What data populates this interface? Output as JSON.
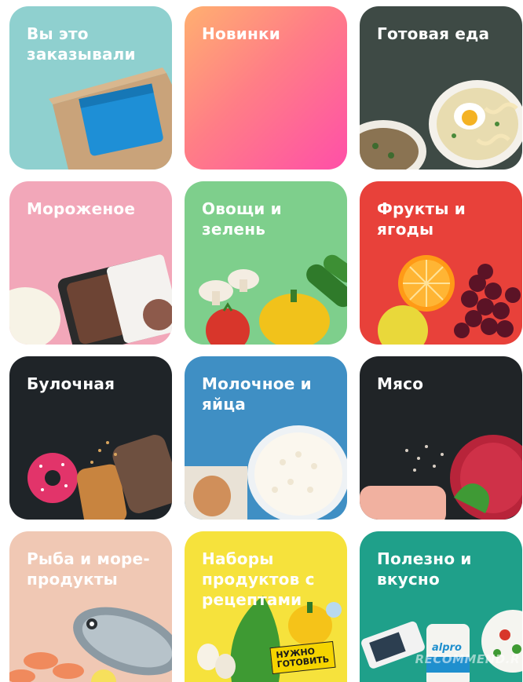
{
  "tiles": [
    {
      "label": "Вы это\nзаказывали"
    },
    {
      "label": "Новинки"
    },
    {
      "label": "Готовая еда"
    },
    {
      "label": "Мороженое"
    },
    {
      "label": "Овощи и\nзелень"
    },
    {
      "label": "Фрукты и\nягоды"
    },
    {
      "label": "Булочная"
    },
    {
      "label": "Молочное и\nяйца"
    },
    {
      "label": "Мясо"
    },
    {
      "label": "Рыба и море-\nпродукты"
    },
    {
      "label": "Наборы\nпродуктов с\nрецептами"
    },
    {
      "label": "Полезно и\nвкусно"
    }
  ],
  "badge": {
    "label": "НУЖНО\nГОТОВИТЬ"
  },
  "product_label": "alpro",
  "watermark": "RECOMMEND.R",
  "colors": {
    "ordered": "#8fd0cf",
    "new_from": "#ff9a6c",
    "new_to": "#ff5c9a",
    "ready_food": "#3e4a45",
    "ice_cream": "#f2a7b9",
    "vegetables": "#7ecf8c",
    "fruits": "#e8413a",
    "bakery": "#1f2428",
    "dairy": "#3f8fc4",
    "meat": "#202427",
    "fish": "#f0c8b4",
    "recipes": "#f6e23c",
    "healthy": "#1fa08a"
  }
}
